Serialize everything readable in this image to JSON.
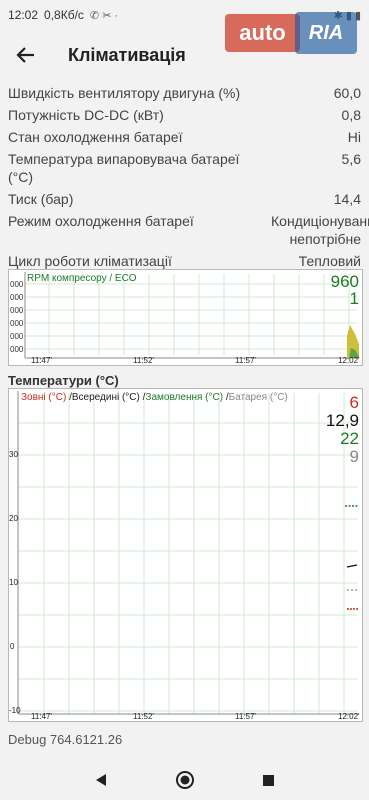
{
  "status_bar": {
    "time": "12:02",
    "speed": "0,8Кб/с",
    "icons_left": "✆ ✂ ·",
    "icons_right": "✱ ▮ ▮"
  },
  "watermark": {
    "part1": "auto",
    "part2": "RIA"
  },
  "app_bar": {
    "title": "Клімативація"
  },
  "params": [
    {
      "label": "Швидкість вентилятору двигуна (%)",
      "value": "60,0"
    },
    {
      "label": "Потужність DC-DC (кВт)",
      "value": "0,8"
    },
    {
      "label": "Стан охолодження батареї",
      "value": "Ні"
    },
    {
      "label": "Температура випаровувача батареї (°C)",
      "value": "5,6"
    },
    {
      "label": "Тиск (бар)",
      "value": "14,4"
    },
    {
      "label": "Режим охолодження батареї",
      "value": "Кондиціонування непотрібне"
    },
    {
      "label": "Цикл роботи кліматизації",
      "value": "Тепловий насос"
    }
  ],
  "chart1": {
    "legend": "RPM компресору / ECO",
    "value1": "960",
    "value2": "1",
    "y_ticks": [
      "000",
      "000",
      "000",
      "000",
      "000",
      "000"
    ],
    "x_ticks": [
      "11:47'",
      "11:52'",
      "11:57'",
      "12:02'"
    ]
  },
  "section_title": "Температури (°C)",
  "chart2": {
    "legend": [
      {
        "text": "Зовні (°C)",
        "color": "#cc2a1c"
      },
      {
        "text": "Всередині (°C)",
        "color": "#222222"
      },
      {
        "text": "Замовлення (°C)",
        "color": "#1e7a2a"
      },
      {
        "text": "Батарея (°C)",
        "color": "#888888"
      }
    ],
    "values": [
      {
        "text": "6",
        "color": "#cc2a1c"
      },
      {
        "text": "12,9",
        "color": "#111111"
      },
      {
        "text": "22",
        "color": "#1e7a2a"
      },
      {
        "text": "9",
        "color": "#888888"
      }
    ],
    "y_ticks": [
      "30",
      "20",
      "10",
      "0",
      "-10"
    ],
    "x_ticks": [
      "11:47'",
      "11:52'",
      "11:57'",
      "12:02'"
    ]
  },
  "debug": "Debug 764.6121.26"
}
